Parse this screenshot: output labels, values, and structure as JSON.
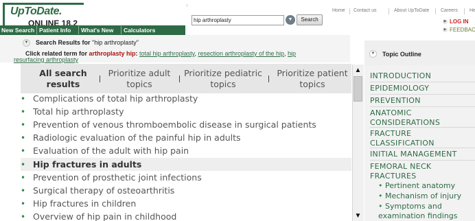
{
  "header": {
    "logo_main": "UpToDate.",
    "logo_sub": "ONLINE 18.2",
    "search_value": "hip arthroplasty",
    "search_button": "Search",
    "top_links": [
      "Home",
      "Contact us",
      "About UpToDate",
      "Careers",
      "He"
    ],
    "login": "LOG IN",
    "feedback": "FEEDBAC"
  },
  "nav": [
    "New Search",
    "Patient Info",
    "What's New",
    "Calculators"
  ],
  "results_info": {
    "prefix": "Search Results for ",
    "query": "\"hip arthroplasty\"",
    "related_prefix": "Click related term for ",
    "related_term": "arthroplasty hip",
    "related_colon": ": ",
    "related_links": [
      "total hip arthroplasty",
      "resection arthroplasty of the hip",
      "hip"
    ],
    "related_link_cont": "resurfacing arthroplasty"
  },
  "tabs": [
    {
      "line1": "All search",
      "line2": "results",
      "active": true
    },
    {
      "line1": "Prioritize adult",
      "line2": "topics",
      "active": false
    },
    {
      "line1": "Prioritize pediatric",
      "line2": "topics",
      "active": false
    },
    {
      "line1": "Prioritize patient",
      "line2": "topics",
      "active": false
    }
  ],
  "results": [
    {
      "title": "Complications of total hip arthroplasty",
      "highlighted": false
    },
    {
      "title": "Total hip arthroplasty",
      "highlighted": false
    },
    {
      "title": "Prevention of venous thromboembolic disease in surgical patients",
      "highlighted": false
    },
    {
      "title": "Radiologic evaluation of the painful hip in adults",
      "highlighted": false
    },
    {
      "title": "Evaluation of the adult with hip pain",
      "highlighted": false
    },
    {
      "title": "Hip fractures in adults",
      "highlighted": true
    },
    {
      "title": "Prevention of prosthetic joint infections",
      "highlighted": false
    },
    {
      "title": "Surgical therapy of osteoarthritis",
      "highlighted": false
    },
    {
      "title": "Hip fractures in children",
      "highlighted": false
    },
    {
      "title": "Overview of hip pain in childhood",
      "highlighted": false
    }
  ],
  "outline": {
    "title": "Topic Outline",
    "items": [
      {
        "label": "INTRODUCTION"
      },
      {
        "label": "EPIDEMIOLOGY"
      },
      {
        "label": "PREVENTION"
      },
      {
        "label": "ANATOMIC CONSIDERATIONS"
      },
      {
        "label": "FRACTURE CLASSIFICATION"
      },
      {
        "label": "INITIAL MANAGEMENT"
      },
      {
        "label": "FEMORAL NECK FRACTURES"
      }
    ],
    "subitems": [
      {
        "label": "Pertinent anatomy"
      },
      {
        "label": "Mechanism of injury"
      },
      {
        "label": "Symptoms and examination findings"
      }
    ]
  },
  "icons": {
    "scroll_up": "scroll-up-arrow-icon",
    "scroll_down": "scroll-down-arrow-icon",
    "expand": "expand-circle-icon"
  },
  "colors": {
    "brand_green": "#2e6b45",
    "bullet_green": "#2e8b4a",
    "login_red": "#cc2222",
    "related_red": "#aa1111"
  }
}
